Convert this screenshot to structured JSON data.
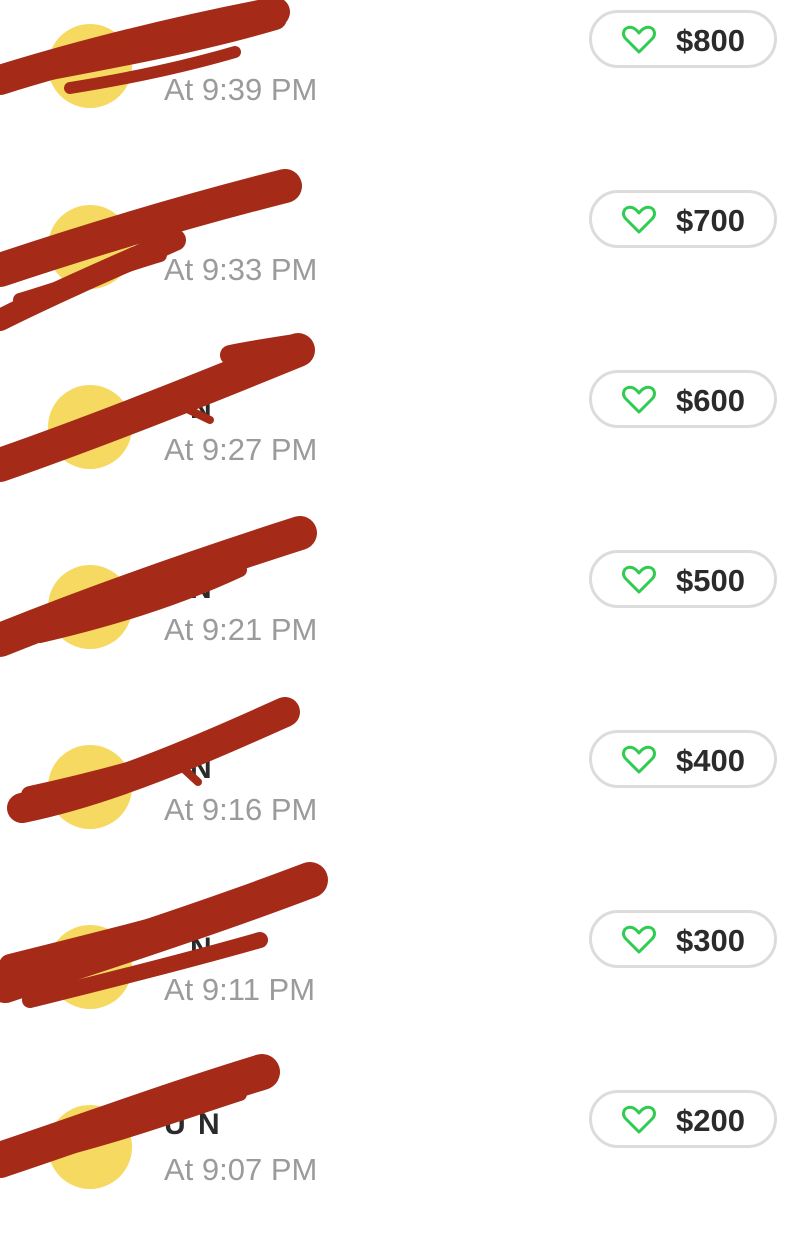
{
  "feed": {
    "items": [
      {
        "name": "",
        "time": "At 9:39 PM",
        "amount": "$800"
      },
      {
        "name": "",
        "time": "At 9:33 PM",
        "amount": "$700"
      },
      {
        "name": "N",
        "time": "At 9:27 PM",
        "amount": "$600"
      },
      {
        "name": "N",
        "time": "At 9:21 PM",
        "amount": "$500"
      },
      {
        "name": "N",
        "time": "At 9:16 PM",
        "amount": "$400"
      },
      {
        "name": "N",
        "time": "At 9:11 PM",
        "amount": "$300"
      },
      {
        "name": "U N",
        "time": "At 9:07 PM",
        "amount": "$200"
      }
    ]
  },
  "icons": {
    "like": "heart-icon"
  },
  "colors": {
    "avatar": "#f5d960",
    "heart": "#2ecc4f",
    "redaction": "#a52a17",
    "time": "#9b9b9b",
    "amount": "#2b2b2b",
    "pill_border": "#dcdcdc"
  }
}
